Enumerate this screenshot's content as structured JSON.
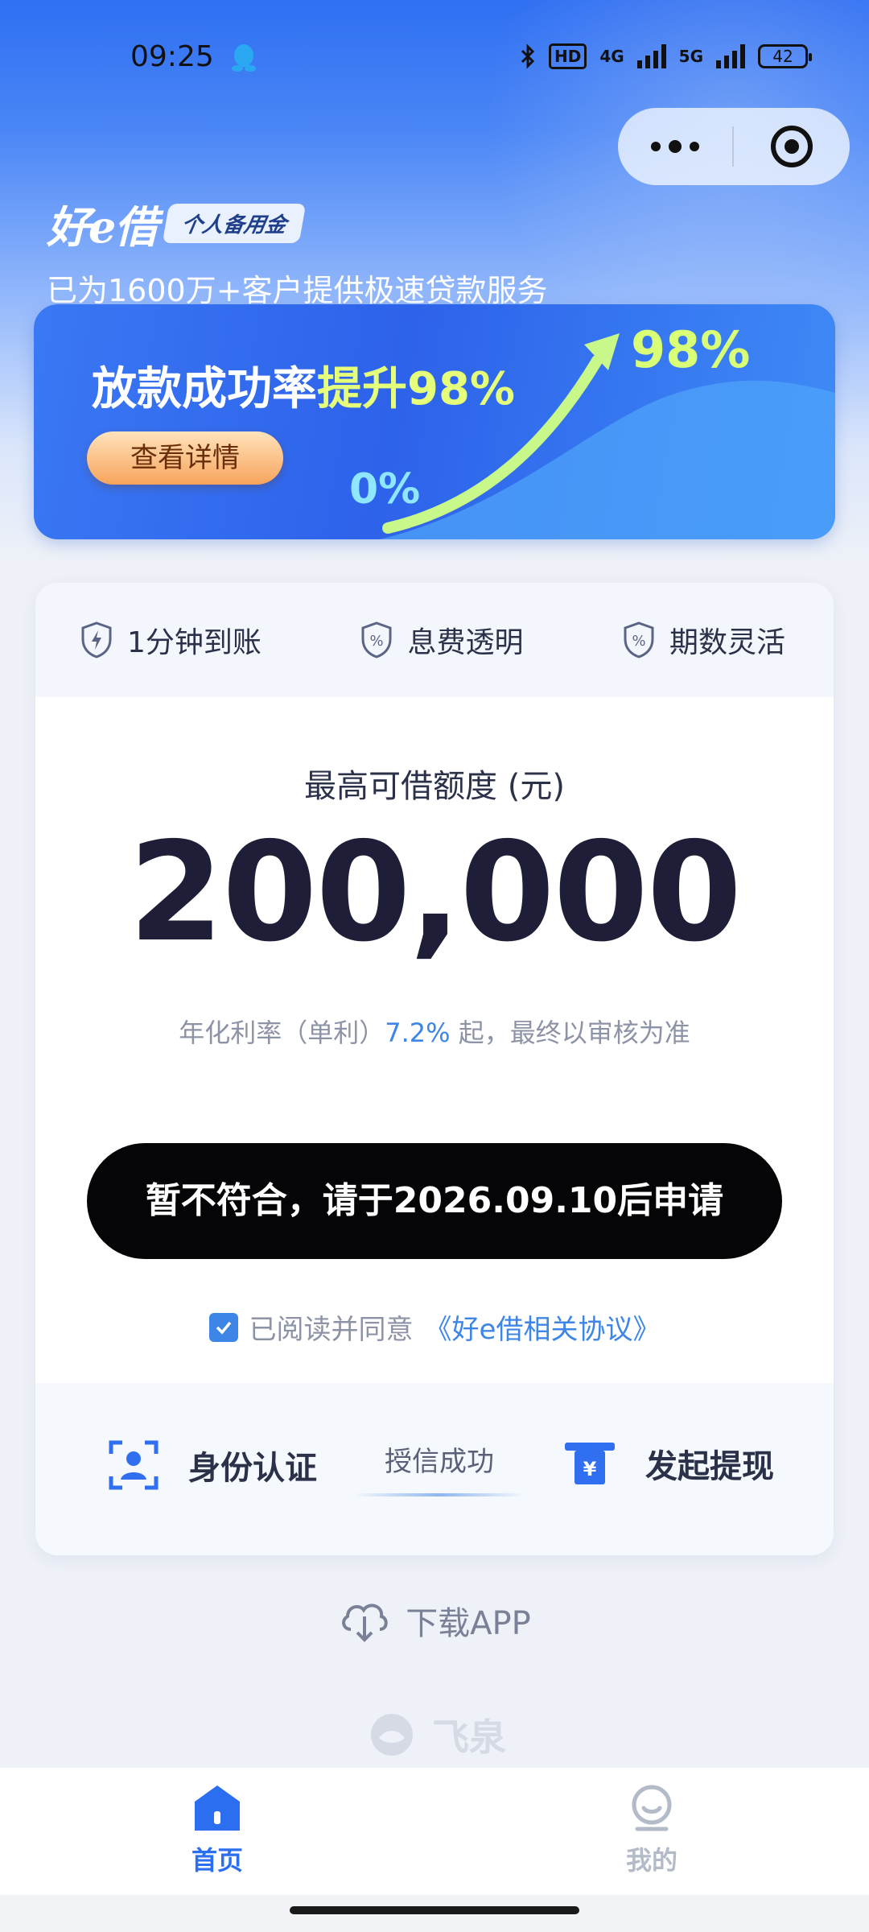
{
  "status_bar": {
    "time": "09:25",
    "hd_label": "HD",
    "net_4g": "4G",
    "net_5g": "5G",
    "battery": "42"
  },
  "brand": {
    "logo": "好e借",
    "tag": "个人备用金",
    "slogan": "已为1600万+客户提供极速贷款服务"
  },
  "banner": {
    "title_prefix": "放款成功率",
    "title_highlight": "提升98%",
    "button": "查看详情",
    "start_value": "0%",
    "end_value": "98%"
  },
  "features": [
    {
      "label": "1分钟到账",
      "icon": "lightning-shield-icon"
    },
    {
      "label": "息费透明",
      "icon": "percent-shield-icon"
    },
    {
      "label": "期数灵活",
      "icon": "percent-shield-icon"
    }
  ],
  "loan": {
    "amount_label": "最高可借额度 (元)",
    "amount": "200,000",
    "rate_prefix": "年化利率（单利）",
    "rate": "7.2%",
    "rate_suffix": " 起，最终以审核为准",
    "apply_button": "暂不符合，请于2026.09.10后申请",
    "agree_text": "已阅读并同意",
    "agree_link": "《好e借相关协议》"
  },
  "steps": {
    "step1": "身份认证",
    "middle": "授信成功",
    "step3": "发起提现"
  },
  "download": {
    "label": "下载APP"
  },
  "watermark": {
    "label": "飞泉"
  },
  "tabbar": {
    "home": "首页",
    "mine": "我的"
  },
  "colors": {
    "accent": "#3d86e8",
    "banner_highlight": "#e6ff7a",
    "button_bg": "#050507"
  }
}
